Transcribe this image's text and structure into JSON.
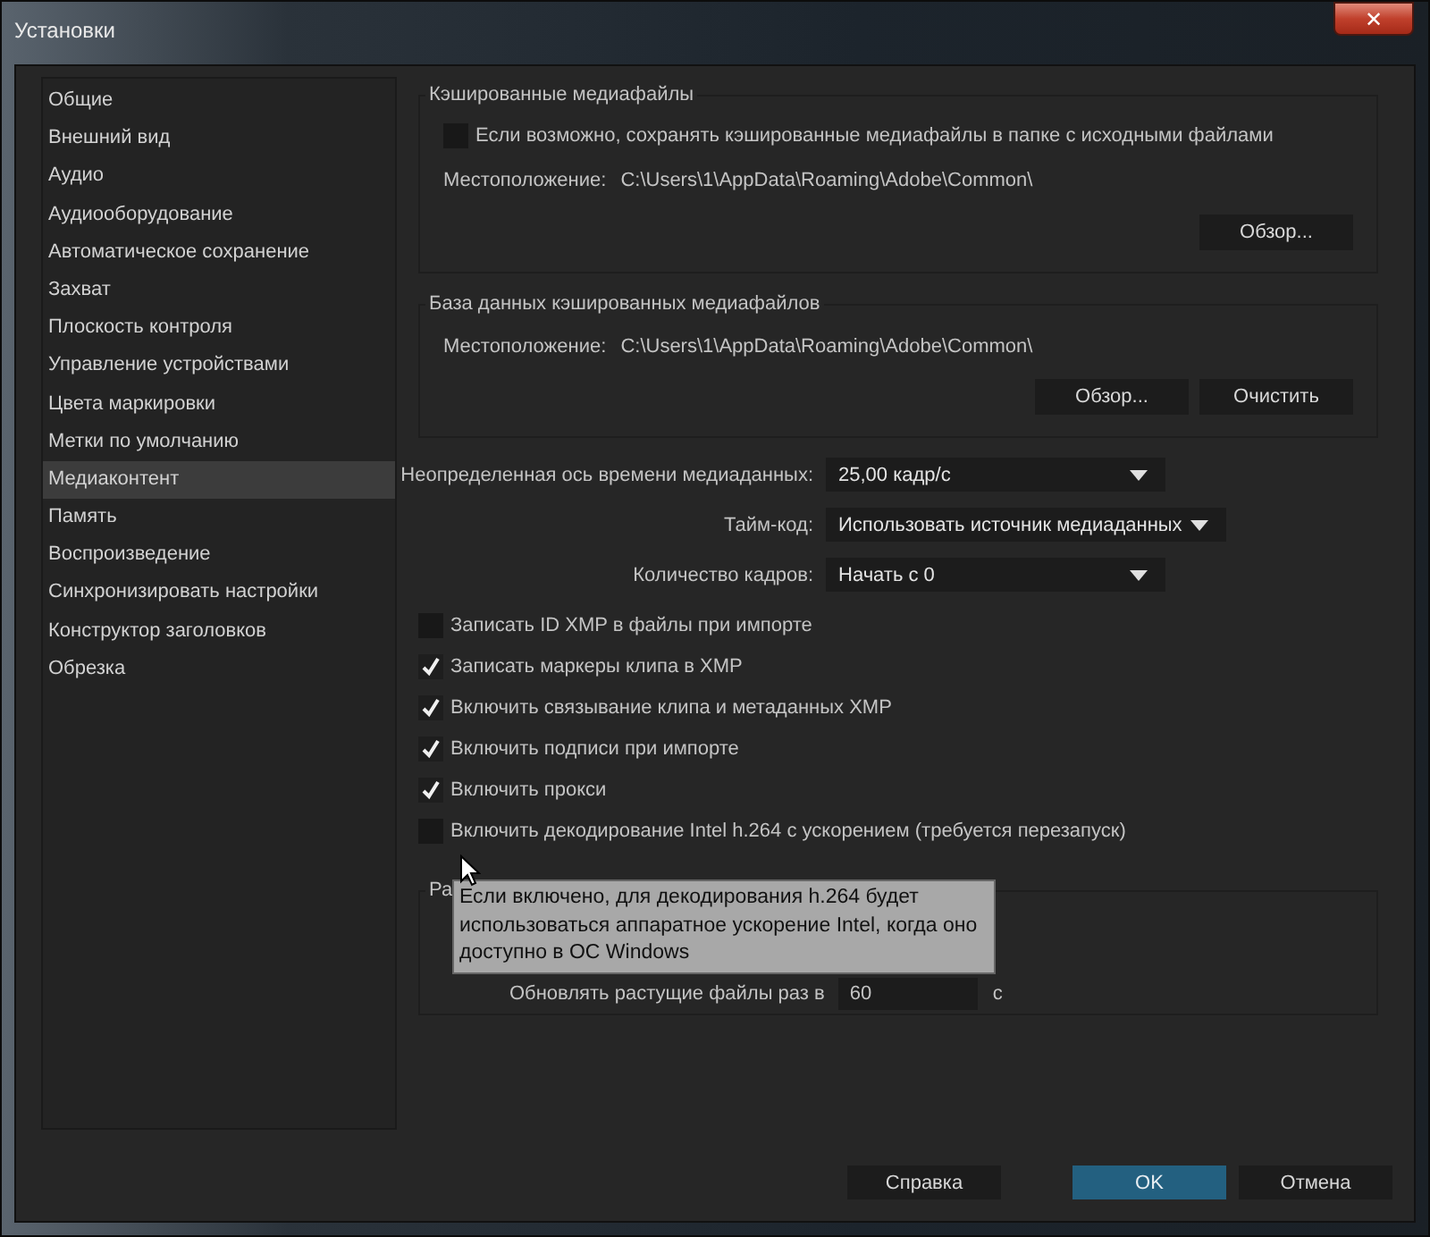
{
  "window": {
    "title": "Установки",
    "close": "✕"
  },
  "sidebar": {
    "items": [
      {
        "label": "Общие",
        "selected": false
      },
      {
        "label": "Внешний вид",
        "selected": false
      },
      {
        "label": "Аудио",
        "selected": false
      },
      {
        "label": "Аудиооборудование",
        "selected": false
      },
      {
        "label": "Автоматическое сохранение",
        "selected": false
      },
      {
        "label": "Захват",
        "selected": false
      },
      {
        "label": "Плоскость контроля",
        "selected": false
      },
      {
        "label": "Управление устройствами",
        "selected": false
      },
      {
        "label": "Цвета маркировки",
        "selected": false
      },
      {
        "label": "Метки по умолчанию",
        "selected": false
      },
      {
        "label": "Медиаконтент",
        "selected": true
      },
      {
        "label": "Память",
        "selected": false
      },
      {
        "label": "Воспроизведение",
        "selected": false
      },
      {
        "label": "Синхронизировать настройки",
        "selected": false
      },
      {
        "label": "Конструктор заголовков",
        "selected": false
      },
      {
        "label": "Обрезка",
        "selected": false
      }
    ]
  },
  "cache_group": {
    "title": "Кэшированные медиафайлы",
    "checkbox": {
      "label": "Если возможно, сохранять кэшированные медиафайлы в папке с исходными файлами",
      "checked": false
    },
    "location_label": "Местоположение:",
    "location": "C:\\Users\\1\\AppData\\Roaming\\Adobe\\Common\\",
    "buttons": [
      "Обзор..."
    ]
  },
  "database_group": {
    "title": "База данных кэшированных медиафайлов",
    "location_label": "Местоположение:",
    "location": "C:\\Users\\1\\AppData\\Roaming\\Adobe\\Common\\",
    "buttons": [
      "Обзор...",
      "Очистить"
    ]
  },
  "dropdowns": [
    {
      "label": "Неопределенная ось времени медиаданных:",
      "value": "25,00 кадр/с",
      "wide": false
    },
    {
      "label": "Тайм-код:",
      "value": "Использовать источник медиаданных",
      "wide": true
    },
    {
      "label": "Количество кадров:",
      "value": "Начать с 0",
      "wide": false
    }
  ],
  "checkboxes": [
    {
      "label": "Записать ID XMP в файлы при импорте",
      "checked": false
    },
    {
      "label": "Записать маркеры клипа в XMP",
      "checked": true
    },
    {
      "label": "Включить связывание клипа и метаданных XMP",
      "checked": true
    },
    {
      "label": "Включить подписи при импорте",
      "checked": true
    },
    {
      "label": "Включить прокси",
      "checked": true
    },
    {
      "label": "Включить декодирование Intel h.264 с ускорением (требуется перезапуск)",
      "checked": false
    }
  ],
  "growing_group": {
    "title": "Ра",
    "refresh_label": "Обновлять растущие файлы раз в",
    "refresh_value": "60",
    "unit": "с"
  },
  "tooltip": "Если включено, для декодирования h.264 будет использоваться аппаратное ускорение Intel, когда оно доступно в ОС Windows",
  "footer": {
    "help": "Справка",
    "ok": "OK",
    "cancel": "Отмена"
  }
}
